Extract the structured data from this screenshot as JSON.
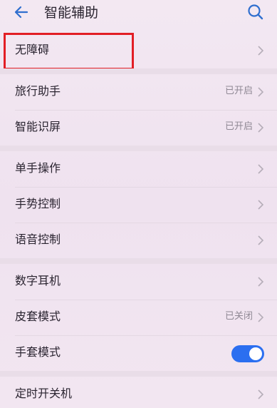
{
  "header": {
    "title": "智能辅助"
  },
  "items": [
    {
      "label": "无障碍",
      "status": ""
    },
    {
      "label": "旅行助手",
      "status": "已开启"
    },
    {
      "label": "智能识屏",
      "status": "已开启"
    },
    {
      "label": "单手操作",
      "status": ""
    },
    {
      "label": "手势控制",
      "status": ""
    },
    {
      "label": "语音控制",
      "status": ""
    },
    {
      "label": "数字耳机",
      "status": ""
    },
    {
      "label": "皮套模式",
      "status": "已关闭"
    },
    {
      "label": "手套模式",
      "status": "",
      "toggle": "on"
    },
    {
      "label": "定时开关机",
      "status": ""
    }
  ],
  "colors": {
    "accent": "#2b6ff0",
    "highlight": "#e21e25"
  },
  "icons": {
    "back": "back-arrow-icon",
    "search": "search-icon",
    "chevron": "chevron-right-icon"
  }
}
